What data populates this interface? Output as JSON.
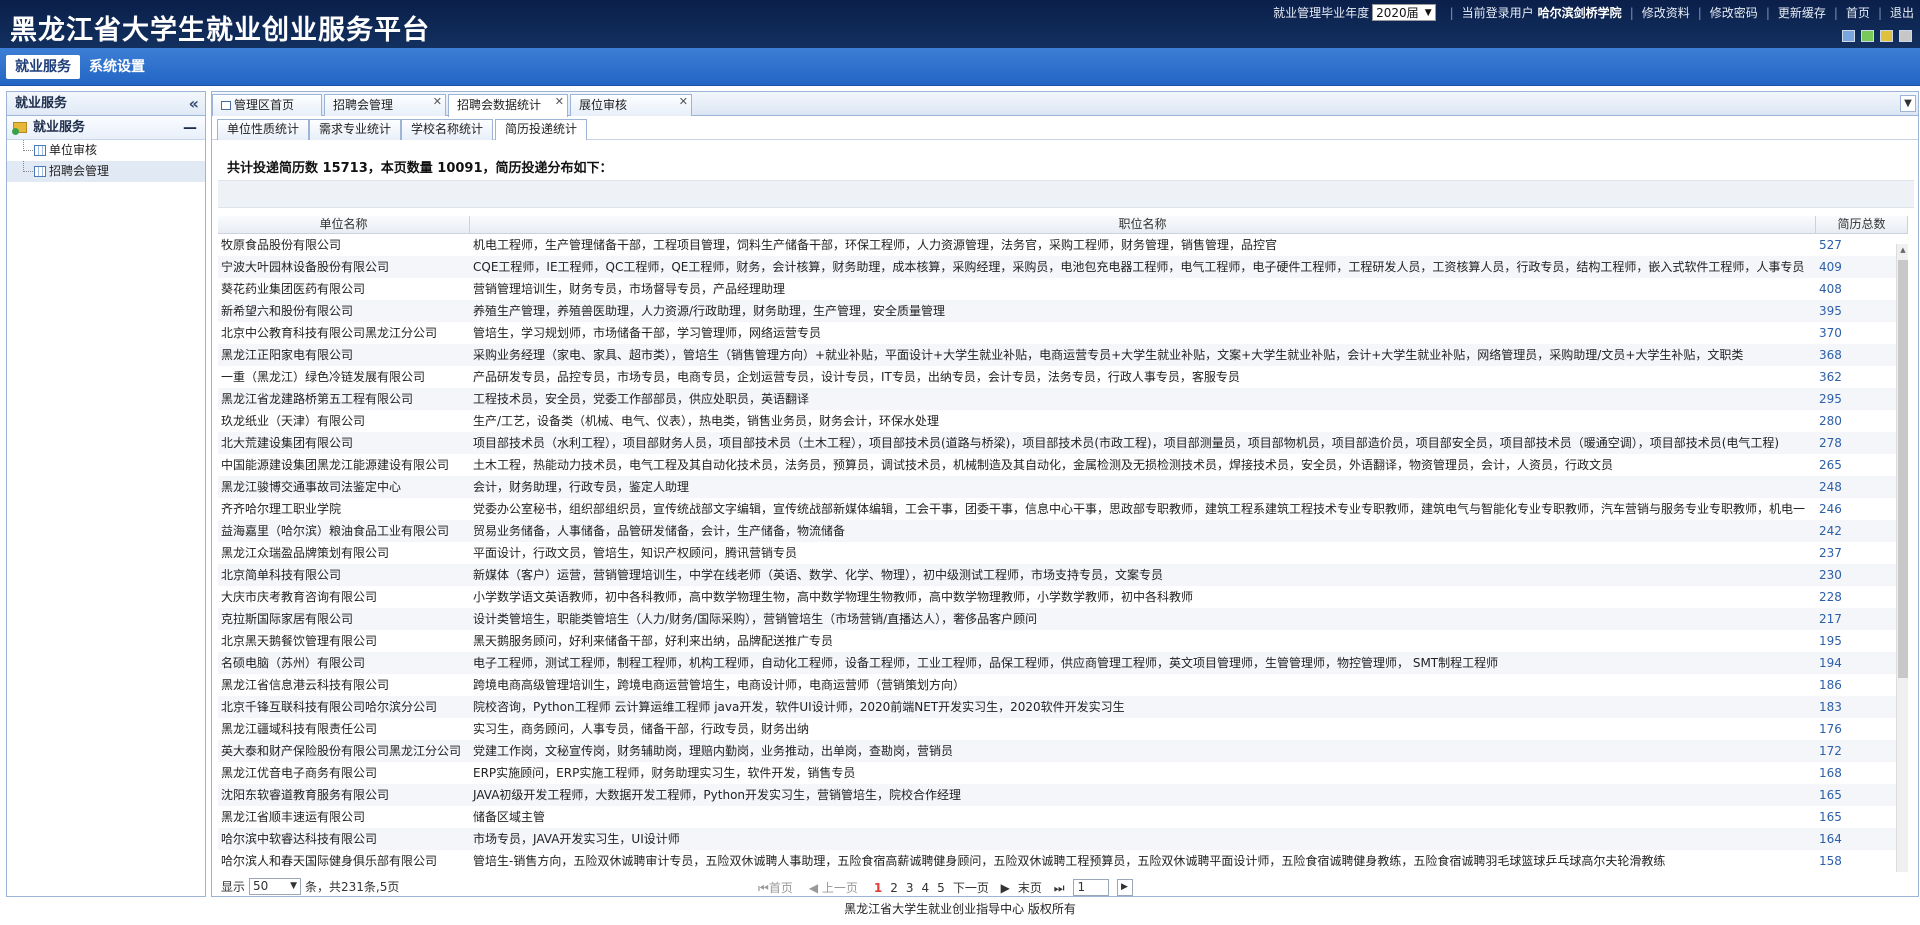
{
  "header": {
    "title": "黑龙江省大学生就业创业服务平台",
    "year_label": "就业管理毕业年度",
    "year_value": "2020届",
    "user_label": "当前登录用户",
    "user_name": "哈尔滨剑桥学院",
    "links": [
      "修改资料",
      "修改密码",
      "更新缓存",
      "首页",
      "退出"
    ],
    "theme_colors": [
      "#7aa6e0",
      "#79c85a",
      "#e0c13e",
      "#c7c7c7"
    ]
  },
  "nav": {
    "items": [
      "就业服务",
      "系统设置"
    ]
  },
  "sidebar": {
    "title": "就业服务",
    "group": "就业服务",
    "items": [
      "单位审核",
      "招聘会管理"
    ]
  },
  "tabs": [
    "管理区首页",
    "招聘会管理",
    "招聘会数据统计",
    "展位审核"
  ],
  "subtabs": [
    "单位性质统计",
    "需求专业统计",
    "学校名称统计",
    "简历投递统计"
  ],
  "summary": "共计投递简历数 15713，本页数量 10091，简历投递分布如下：",
  "grid": {
    "columns": [
      "单位名称",
      "职位名称",
      "简历总数"
    ],
    "rows": [
      [
        "牧原食品股份有限公司",
        "机电工程师，生产管理储备干部，工程项目管理，饲料生产储备干部，环保工程师，人力资源管理，法务官，采购工程师，财务管理，销售管理，品控官",
        "527"
      ],
      [
        "宁波大叶园林设备股份有限公司",
        "CQE工程师，IE工程师，QC工程师，QE工程师，财务，会计核算，财务助理，成本核算，采购经理，采购员，电池包充电器工程师，电气工程师，电子硬件工程师，工程研发人员，工资核算人员，行政专员，结构工程师，嵌入式软件工程师，人事专员",
        "409"
      ],
      [
        "葵花药业集团医药有限公司",
        "营销管理培训生，财务专员，市场督导专员，产品经理助理",
        "408"
      ],
      [
        "新希望六和股份有限公司",
        "养殖生产管理，养殖兽医助理，人力资源/行政助理，财务助理，生产管理，安全质量管理",
        "395"
      ],
      [
        "北京中公教育科技有限公司黑龙江分公司",
        "管培生，学习规划师，市场储备干部，学习管理师，网络运营专员",
        "370"
      ],
      [
        "黑龙江正阳家电有限公司",
        "采购业务经理（家电、家具、超市类），管培生（销售管理方向）+就业补贴，平面设计+大学生就业补贴，电商运营专员+大学生就业补贴，文案+大学生就业补贴，会计+大学生就业补贴，网络管理员，采购助理/文员+大学生补贴，文职类",
        "368"
      ],
      [
        "一重（黑龙江）绿色冷链发展有限公司",
        "产品研发专员，品控专员，市场专员，电商专员，企划运营专员，设计专员，IT专员，出纳专员，会计专员，法务专员，行政人事专员，客服专员",
        "362"
      ],
      [
        "黑龙江省龙建路桥第五工程有限公司",
        "工程技术员，安全员，党委工作部部员，供应处职员，英语翻译",
        "295"
      ],
      [
        "玖龙纸业（天津）有限公司",
        "生产/工艺，设备类（机械、电气、仪表），热电类，销售业务员，财务会计，环保水处理",
        "280"
      ],
      [
        "北大荒建设集团有限公司",
        "项目部技术员（水利工程），项目部财务人员，项目部技术员（土木工程），项目部技术员(道路与桥梁)，项目部技术员(市政工程)，项目部测量员，项目部物机员，项目部造价员，项目部安全员，项目部技术员（暖通空调），项目部技术员(电气工程)",
        "278"
      ],
      [
        "中国能源建设集团黑龙江能源建设有限公司",
        "土木工程，热能动力技术员，电气工程及其自动化技术员，法务员，预算员，调试技术员，机械制造及其自动化，金属检测及无损检测技术员，焊接技术员，安全员，外语翻译，物资管理员，会计，人资员，行政文员",
        "265"
      ],
      [
        "黑龙江骏博交通事故司法鉴定中心",
        "会计，财务助理，行政专员，鉴定人助理",
        "248"
      ],
      [
        "齐齐哈尔理工职业学院",
        "党委办公室秘书，组织部组织员，宣传统战部文字编辑，宣传统战部新媒体编辑，工会干事，团委干事，信息中心干事，思政部专职教师，建筑工程系建筑工程技术专业专职教师，建筑电气与智能化专业专职教师，汽车营销与服务专业专职教师，机电一",
        "246"
      ],
      [
        "益海嘉里（哈尔滨）粮油食品工业有限公司",
        "贸易业务储备，人事储备，品管研发储备，会计，生产储备，物流储备",
        "242"
      ],
      [
        "黑龙江众瑞盈品牌策划有限公司",
        "平面设计，行政文员，管培生，知识产权顾问，腾讯营销专员",
        "237"
      ],
      [
        "北京简单科技有限公司",
        "新媒体（客户）运营，营销管理培训生，中学在线老师（英语、数学、化学、物理），初中级测试工程师，市场支持专员，文案专员",
        "230"
      ],
      [
        "大庆市庆考教育咨询有限公司",
        "小学数学语文英语教师，初中各科教师，高中数学物理生物，高中数学物理生物教师，高中数学物理教师，小学数学教师，初中各科教师",
        "228"
      ],
      [
        "克拉斯国际家居有限公司",
        "设计类管培生，职能类管培生（人力/财务/国际采购），营销管培生（市场营销/直播达人），奢侈品客户顾问",
        "217"
      ],
      [
        "北京黑天鹅餐饮管理有限公司",
        "黑天鹅服务顾问，好利来储备干部，好利来出纳，品牌配送推广专员",
        "195"
      ],
      [
        "名硕电脑（苏州）有限公司",
        "电子工程师，测试工程师，制程工程师，机构工程师，自动化工程师，设备工程师，工业工程师，品保工程师，供应商管理工程师，英文项目管理师，生管管理师，物控管理师， SMT制程工程师",
        "194"
      ],
      [
        "黑龙江省信息港云科技有限公司",
        "跨境电商高级管理培训生，跨境电商运营管培生，电商设计师，电商运营师（营销策划方向）",
        "186"
      ],
      [
        "北京千锋互联科技有限公司哈尔滨分公司",
        "院校咨询，Python工程师 云计算运维工程师 java开发，软件UI设计师，2020前端NET开发实习生，2020软件开发实习生",
        "183"
      ],
      [
        "黑龙江疆域科技有限责任公司",
        "实习生，商务顾问，人事专员，储备干部，行政专员，财务出纳",
        "176"
      ],
      [
        "英大泰和财产保险股份有限公司黑龙江分公司",
        "党建工作岗，文秘宣传岗，财务辅助岗，理赔内勤岗，业务推动，出单岗，查勘岗，营销员",
        "172"
      ],
      [
        "黑龙江优音电子商务有限公司",
        "ERP实施顾问，ERP实施工程师，财务助理实习生，软件开发，销售专员",
        "168"
      ],
      [
        "沈阳东软睿道教育服务有限公司",
        "JAVA初级开发工程师，大数据开发工程师，Python开发实习生，营销管培生，院校合作经理",
        "165"
      ],
      [
        "黑龙江省顺丰速运有限公司",
        "储备区域主管",
        "165"
      ],
      [
        "哈尔滨中软睿达科技有限公司",
        "市场专员，JAVA开发实习生，UI设计师",
        "164"
      ],
      [
        "哈尔滨人和春天国际健身俱乐部有限公司",
        "管培生-销售方向，五险双休诚聘审计专员，五险双休诚聘人事助理，五险食宿高薪诚聘健身顾问，五险双休诚聘工程预算员，五险双休诚聘平面设计师，五险食宿诚聘健身教练，五险食宿诚聘羽毛球篮球乒乓球高尔夫轮滑教练",
        "158"
      ]
    ]
  },
  "pager": {
    "show_label": "显示",
    "page_size": "50",
    "count_text": "条，共231条,5页",
    "first": "首页",
    "prev": "上一页",
    "pages": [
      "1",
      "2",
      "3",
      "4",
      "5"
    ],
    "current_page": "1",
    "next": "下一页",
    "last": "末页",
    "page_input": "1"
  },
  "footer": "黑龙江省大学生就业创业指导中心 版权所有"
}
